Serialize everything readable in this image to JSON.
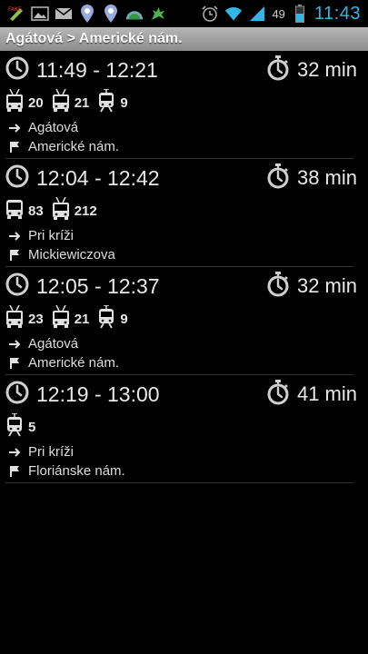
{
  "status_bar": {
    "battery_percent": "49",
    "clock": "11:43",
    "accent_color": "#33b5e5"
  },
  "title_bar": {
    "title": "Agátová > Americké nám."
  },
  "connections": [
    {
      "time": "11:49 - 12:21",
      "duration": "32 min",
      "vehicles": [
        {
          "type": "trolleybus",
          "number": "20"
        },
        {
          "type": "trolleybus",
          "number": "21"
        },
        {
          "type": "tram",
          "number": "9"
        }
      ],
      "from": "Agátová",
      "to": "Americké nám."
    },
    {
      "time": "12:04 - 12:42",
      "duration": "38 min",
      "vehicles": [
        {
          "type": "bus",
          "number": "83"
        },
        {
          "type": "trolleybus",
          "number": "212"
        }
      ],
      "from": "Pri kríži",
      "to": "Mickiewiczova"
    },
    {
      "time": "12:05 - 12:37",
      "duration": "32 min",
      "vehicles": [
        {
          "type": "trolleybus",
          "number": "23"
        },
        {
          "type": "trolleybus",
          "number": "21"
        },
        {
          "type": "tram",
          "number": "9"
        }
      ],
      "from": "Agátová",
      "to": "Americké nám."
    },
    {
      "time": "12:19 - 13:00",
      "duration": "41 min",
      "vehicles": [
        {
          "type": "tram",
          "number": "5"
        }
      ],
      "from": "Pri kríži",
      "to": "Floriánske nám."
    }
  ]
}
